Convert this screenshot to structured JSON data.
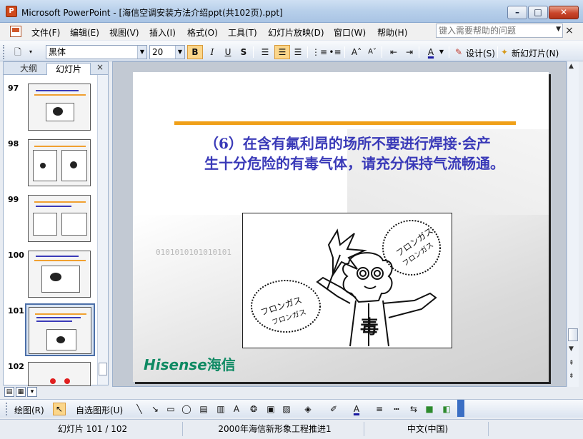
{
  "window": {
    "app_icon": "P",
    "title": "Microsoft PowerPoint - [海信空调安装方法介绍ppt(共102页).ppt]",
    "min_glyph": "–",
    "max_glyph": "□",
    "close_glyph": "✕"
  },
  "menu": {
    "items": [
      "文件(F)",
      "编辑(E)",
      "视图(V)",
      "插入(I)",
      "格式(O)",
      "工具(T)",
      "幻灯片放映(D)",
      "窗口(W)",
      "帮助(H)"
    ],
    "help_placeholder": "键入需要帮助的问题",
    "doc_close": "×"
  },
  "toolbar": {
    "font_name": "黑体",
    "font_size": "20",
    "bold": "B",
    "italic": "I",
    "underline": "U",
    "shadow": "S",
    "design_label": "设计(S)",
    "new_slide_label": "新幻灯片(N)"
  },
  "left_panel": {
    "tab_outline": "大纲",
    "tab_slides": "幻灯片",
    "close": "×",
    "thumbnails": [
      {
        "number": "97"
      },
      {
        "number": "98"
      },
      {
        "number": "99"
      },
      {
        "number": "100"
      },
      {
        "number": "101"
      },
      {
        "number": "102"
      }
    ],
    "selected_slide": "101"
  },
  "slide": {
    "text": "（6）在含有氟利昂的场所不要进行焊接·会产生十分危险的有毒气体，请充分保持气流畅通。",
    "binary_watermark": "0101010101010101",
    "logo_text": "Hisense",
    "logo_cn": "海信",
    "cartoon": {
      "bubble_top": "フロンガス",
      "bubble_top_2": "フロンガス",
      "bubble_left": "フロンガス",
      "bubble_left_2": "フロンガス",
      "shirt_text": "毒"
    }
  },
  "draw_toolbar": {
    "draw_label": "绘图(R)",
    "autoshape_label": "自选图形(U)"
  },
  "status": {
    "slide_position": "幻灯片 101 / 102",
    "template": "2000年海信新形象工程推进1",
    "language": "中文(中国)"
  },
  "colors": {
    "slide_text": "#3a3ab8",
    "rule": "#f0a018",
    "logo": "#0f8a63"
  }
}
